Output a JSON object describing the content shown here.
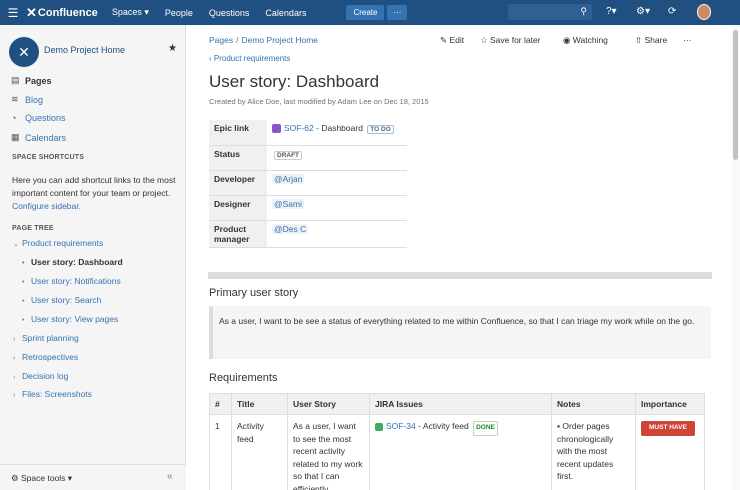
{
  "topnav": {
    "app_name": "Confluence",
    "items": [
      "Spaces ▾",
      "People",
      "Questions",
      "Calendars"
    ],
    "create_label": "Create",
    "more_label": "···"
  },
  "sidebar": {
    "space_name": "Demo Project Home",
    "nav": [
      {
        "label": "Pages",
        "icon": "pages-icon"
      },
      {
        "label": "Blog",
        "icon": "rss-icon"
      },
      {
        "label": "Questions",
        "icon": "question-icon"
      },
      {
        "label": "Calendars",
        "icon": "calendar-icon"
      }
    ],
    "shortcuts_heading": "SPACE SHORTCUTS",
    "shortcuts_text": "Here you can add shortcut links to the most important content for your team or project.",
    "configure_link": "Configure sidebar.",
    "page_tree_heading": "PAGE TREE",
    "tree": [
      {
        "label": "Product requirements",
        "level": 0,
        "arrow": "⌄",
        "active": false
      },
      {
        "label": "User story: Dashboard",
        "level": 1,
        "arrow": "•",
        "active": true
      },
      {
        "label": "User story: Notifications",
        "level": 1,
        "arrow": "•",
        "active": false
      },
      {
        "label": "User story: Search",
        "level": 1,
        "arrow": "•",
        "active": false
      },
      {
        "label": "User story: View pages",
        "level": 1,
        "arrow": "•",
        "active": false
      },
      {
        "label": "Sprint planning",
        "level": 0,
        "arrow": "›",
        "active": false
      },
      {
        "label": "Retrospectives",
        "level": 0,
        "arrow": "›",
        "active": false
      },
      {
        "label": "Decision log",
        "level": 0,
        "arrow": "›",
        "active": false
      },
      {
        "label": "Files: Screenshots",
        "level": 0,
        "arrow": "›",
        "active": false
      }
    ],
    "space_tools": "Space tools ▾",
    "collapse": "«"
  },
  "page": {
    "breadcrumb": [
      "Pages",
      "Demo Project Home"
    ],
    "actions": [
      "Edit",
      "Save for later",
      "Watching",
      "Share",
      "···"
    ],
    "parent_link": "Product requirements",
    "title": "User story: Dashboard",
    "byline": "Created by Alice Doe, last modified by Adam Lee on Dec 18, 2015",
    "details": [
      {
        "key": "Epic link",
        "issue_key": "SOF-62",
        "issue_summary": "- Dashboard",
        "status": "TO DO"
      },
      {
        "key": "Status",
        "status_badge": "DRAFT"
      },
      {
        "key": "Developer",
        "mention": "@Arjan"
      },
      {
        "key": "Designer",
        "mention": "@Sami"
      },
      {
        "key": "Product manager",
        "mention": "@Des C"
      }
    ],
    "primary_heading": "Primary user story",
    "primary_story": "As a user, I want to be see a status of everything related to me within Confluence, so that I can triage my work while on the go.",
    "requirements_heading": "Requirements",
    "req_headers": [
      "#",
      "Title",
      "User Story",
      "JIRA Issues",
      "Notes",
      "Importance"
    ],
    "req_rows": [
      {
        "num": "1",
        "title": "Activity feed",
        "story": "As a user, I want to see the most recent activity related to my work so that I can efficiently",
        "jira_key": "SOF-34",
        "jira_summary": "- Activity feed",
        "jira_status": "DONE",
        "notes": "Order pages chronologically with the most recent updates first.",
        "importance": "MUST HAVE"
      }
    ]
  },
  "colors": {
    "nav_bg": "#205081",
    "link": "#3572b0",
    "must_have": "#d04437",
    "done": "#14892c"
  }
}
